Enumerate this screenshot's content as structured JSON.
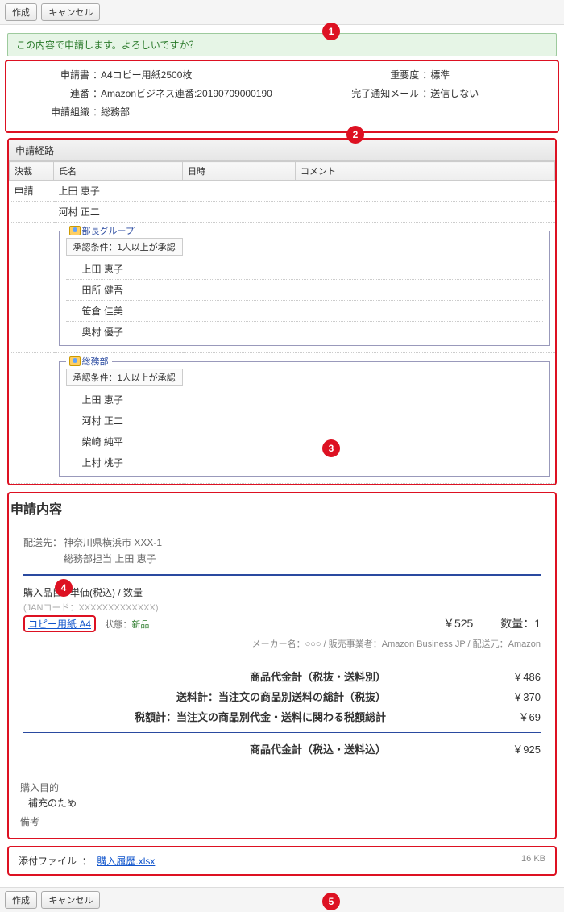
{
  "buttons": {
    "create": "作成",
    "cancel": "キャンセル"
  },
  "confirm_message": "この内容で申請します。よろしいですか？",
  "summary": {
    "title_label": "申請書",
    "title_value": "A4コピー用紙2500枚",
    "seq_label": "連番",
    "seq_value": "Amazonビジネス連番:20190709000190",
    "org_label": "申請組織",
    "org_value": "総務部",
    "importance_label": "重要度",
    "importance_value": "標準",
    "mail_label": "完了通知メール",
    "mail_value": "送信しない"
  },
  "route": {
    "title": "申請経路",
    "cols": {
      "decision": "決裁",
      "name": "氏名",
      "date": "日時",
      "comment": "コメント"
    },
    "apply_label": "申請",
    "applicants": [
      "上田 恵子",
      "河村 正二"
    ],
    "groups": [
      {
        "name": "部長グループ",
        "condition": "承認条件：1人以上が承認",
        "members": [
          "上田 恵子",
          "田所 健吾",
          "笹倉 佳美",
          "奥村 優子"
        ]
      },
      {
        "name": "総務部",
        "condition": "承認条件：1人以上が承認",
        "members": [
          "上田 恵子",
          "河村 正二",
          "柴崎 純平",
          "上村 桃子"
        ]
      }
    ]
  },
  "content": {
    "heading": "申請内容",
    "ship_label": "配送先：",
    "ship_addr": "神奈川県横浜市 XXX-1",
    "ship_person": "総務部担当 上田 恵子",
    "items_label": "購入品目 / 単価(税込) / 数量",
    "jan": "(JANコード：XXXXXXXXXXXXX)",
    "product": "コピー用紙 A4",
    "state_label": "状態：",
    "state_value": "新品",
    "price": "￥525",
    "qty_label": "数量：",
    "qty_value": "1",
    "meta": "メーカー名：○○○ / 販売事業者：Amazon Business JP / 配送元：Amazon",
    "totals": [
      {
        "label": "商品代金計（税抜・送料別）",
        "value": "￥486"
      },
      {
        "label": "送料計：当注文の商品別送料の総計（税抜）",
        "value": "￥370"
      },
      {
        "label": "税額計：当注文の商品別代金・送料に関わる税額総計",
        "value": "￥69"
      }
    ],
    "grand_label": "商品代金計（税込・送料込）",
    "grand_value": "￥925",
    "purpose_label": "購入目的",
    "purpose_value": "補充のため",
    "remark_label": "備考"
  },
  "attachment": {
    "label": "添付ファイル",
    "file": "購入履歴.xlsx",
    "size": "16 KB"
  },
  "markers": [
    "1",
    "2",
    "3",
    "4",
    "5"
  ]
}
